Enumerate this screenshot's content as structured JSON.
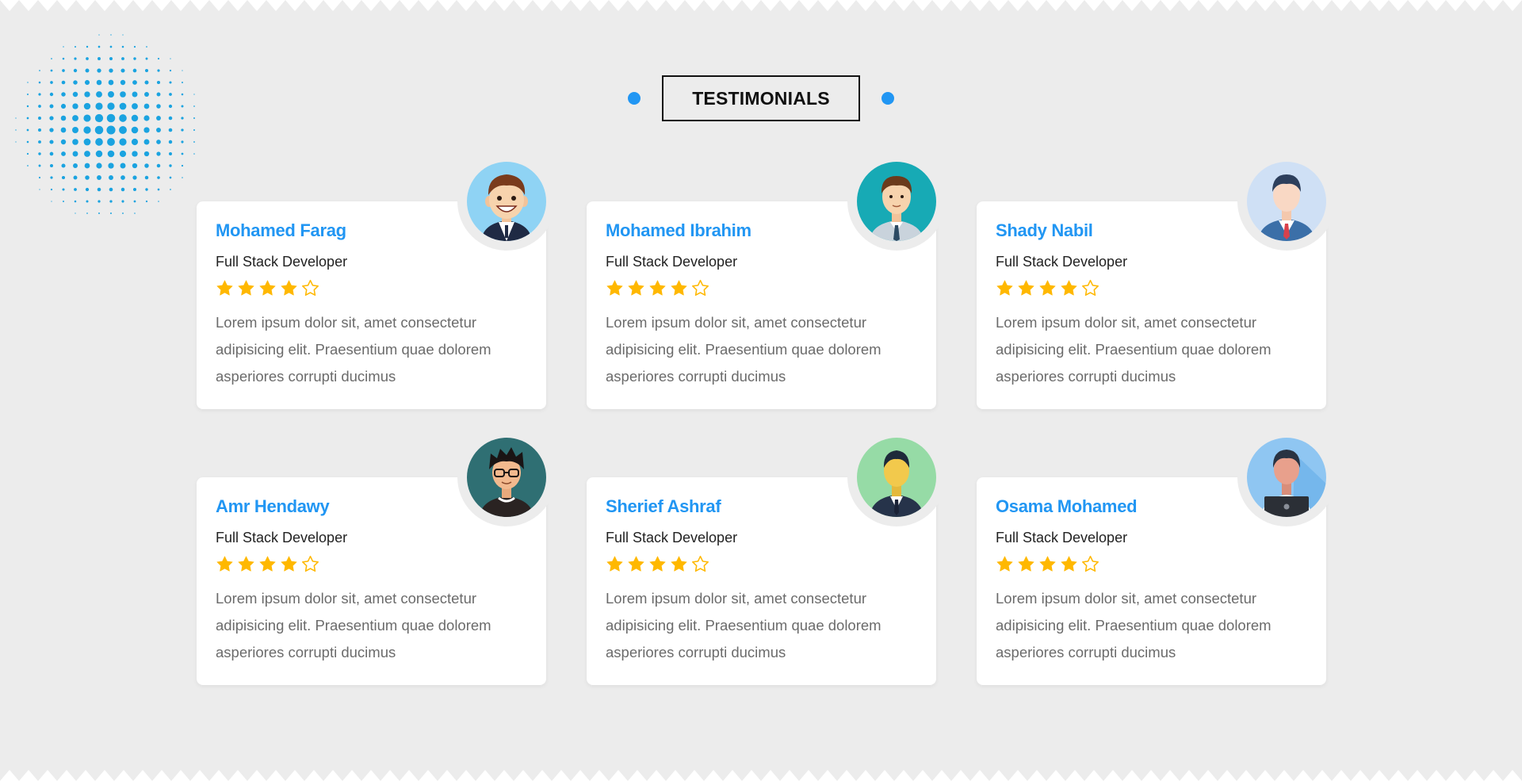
{
  "section": {
    "title": "TESTIMONIALS"
  },
  "colors": {
    "accent": "#2196f3",
    "star": "#ffb800",
    "background": "#ececec",
    "card": "#ffffff"
  },
  "testimonials": [
    {
      "name": "Mohamed Farag",
      "role": "Full Stack Developer",
      "rating": 4,
      "max_rating": 5,
      "text": "Lorem ipsum dolor sit, amet consectetur adipisicing elit. Praesentium quae dolorem asperiores corrupti ducimus",
      "avatar": "smiling-man-avatar-icon"
    },
    {
      "name": "Mohamed Ibrahim",
      "role": "Full Stack Developer",
      "rating": 4,
      "max_rating": 5,
      "text": "Lorem ipsum dolor sit, amet consectetur adipisicing elit. Praesentium quae dolorem asperiores corrupti ducimus",
      "avatar": "businessman-avatar-icon"
    },
    {
      "name": "Shady Nabil",
      "role": "Full Stack Developer",
      "rating": 4,
      "max_rating": 5,
      "text": "Lorem ipsum dolor sit, amet consectetur adipisicing elit. Praesentium quae dolorem asperiores corrupti ducimus",
      "avatar": "suit-man-avatar-icon"
    },
    {
      "name": "Amr Hendawy",
      "role": "Full Stack Developer",
      "rating": 4,
      "max_rating": 5,
      "text": "Lorem ipsum dolor sit, amet consectetur adipisicing elit. Praesentium quae dolorem asperiores corrupti ducimus",
      "avatar": "glasses-man-avatar-icon"
    },
    {
      "name": "Sherief Ashraf",
      "role": "Full Stack Developer",
      "rating": 4,
      "max_rating": 5,
      "text": "Lorem ipsum dolor sit, amet consectetur adipisicing elit. Praesentium quae dolorem asperiores corrupti ducimus",
      "avatar": "blazer-man-avatar-icon"
    },
    {
      "name": "Osama Mohamed",
      "role": "Full Stack Developer",
      "rating": 4,
      "max_rating": 5,
      "text": "Lorem ipsum dolor sit, amet consectetur adipisicing elit. Praesentium quae dolorem asperiores corrupti ducimus",
      "avatar": "laptop-man-avatar-icon"
    }
  ]
}
